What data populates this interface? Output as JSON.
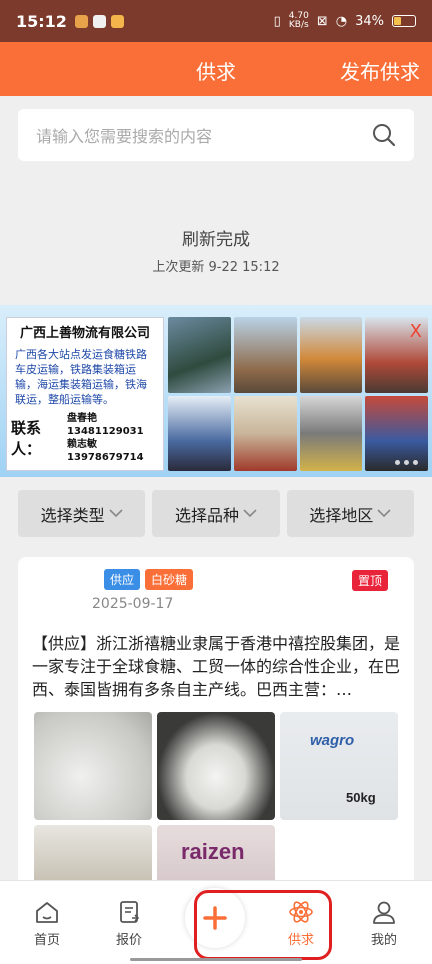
{
  "status": {
    "time": "15:12",
    "net_speed": "4.70",
    "net_unit": "KB/s",
    "battery": "34%"
  },
  "header": {
    "title": "供求",
    "publish_label": "发布供求"
  },
  "search": {
    "placeholder": "请输入您需要搜索的内容"
  },
  "refresh": {
    "message": "刷新完成",
    "last_update": "上次更新 9-22 15:12"
  },
  "banner": {
    "company": "广西上善物流有限公司",
    "description": "广西各大站点发运食糖铁路车皮运输，铁路集装箱运输，海运集装箱运输，铁海联运，整船运输等。",
    "contact_label": "联系人：",
    "contact_1": "盘春艳13481129031",
    "contact_2": "赖志敏13978679714",
    "close_label": "X"
  },
  "filters": [
    {
      "label": "选择类型"
    },
    {
      "label": "选择品种"
    },
    {
      "label": "选择地区"
    }
  ],
  "post": {
    "tag_type": "供应",
    "tag_variety": "白砂糖",
    "top_badge": "置顶",
    "date": "2025-09-17",
    "content": "【供应】浙江浙禧糖业隶属于香港中禧控股集团，是一家专注于全球食糖、工贸一体的综合性企业，在巴西、泰国皆拥有多条自主产线。巴西主营：…",
    "image_labels": {
      "wagro": "wagro",
      "weight": "50kg",
      "raizen": "raizen"
    }
  },
  "tabbar": {
    "items": [
      {
        "label": "首页",
        "icon": "home-icon",
        "active": false
      },
      {
        "label": "报价",
        "icon": "quote-icon",
        "active": false
      },
      {
        "label": "供求",
        "icon": "supply-icon",
        "active": true
      },
      {
        "label": "我的",
        "icon": "user-icon",
        "active": false
      }
    ],
    "fab_icon": "plus-icon"
  },
  "colors": {
    "brand": "#fa6f38",
    "status_bar": "#7b3a2b",
    "highlight": "#e02020"
  }
}
